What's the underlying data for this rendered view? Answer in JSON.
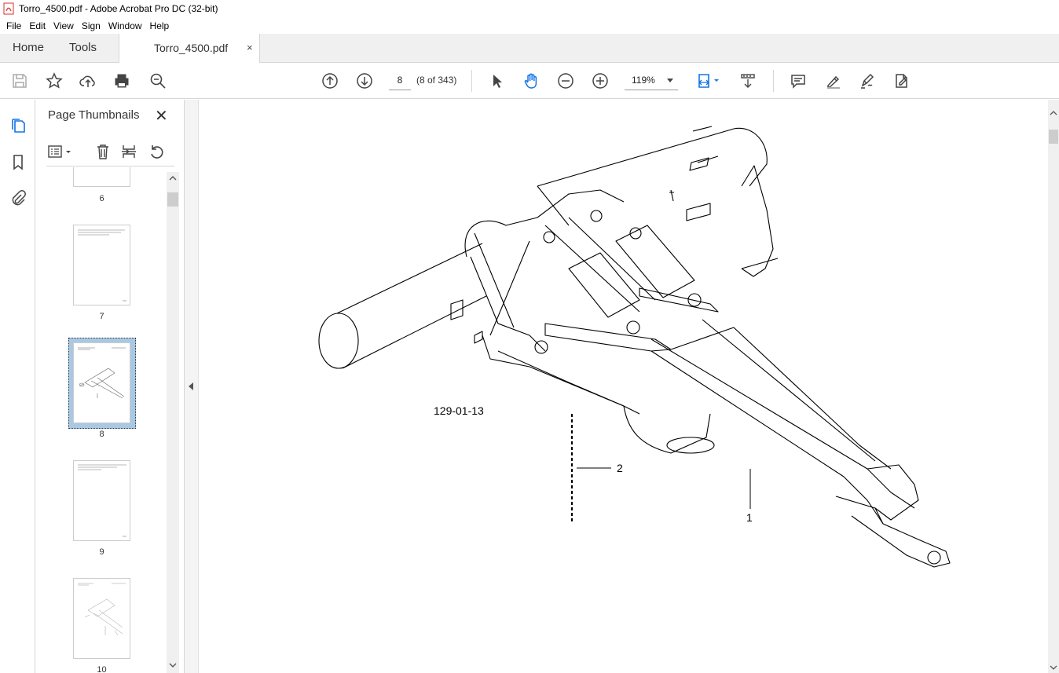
{
  "window": {
    "title": "Torro_4500.pdf - Adobe Acrobat Pro DC (32-bit)"
  },
  "menu": [
    "File",
    "Edit",
    "View",
    "Sign",
    "Window",
    "Help"
  ],
  "tabs": {
    "home": "Home",
    "tools": "Tools",
    "document": "Torro_4500.pdf",
    "close": "×"
  },
  "toolbar": {
    "page_value": "8",
    "page_count": "(8 of 343)",
    "zoom": "119%"
  },
  "panel": {
    "title": "Page Thumbnails",
    "close": "✕",
    "thumbnails": [
      "6",
      "7",
      "8",
      "9",
      "10"
    ],
    "selected": "8"
  },
  "drawing": {
    "figure_id": "129-01-13",
    "callout_1": "1",
    "callout_2": "2"
  },
  "colors": {
    "accent": "#1473e6",
    "selection": "#a8c8e4",
    "pdf_red": "#d9302c"
  }
}
